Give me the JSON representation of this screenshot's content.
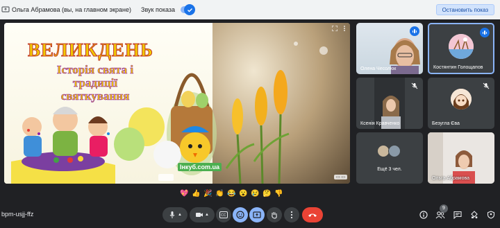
{
  "topbar": {
    "presenter_text": "Ольга Абрамова (вы, на главном экране)",
    "sound_label": "Звук показа",
    "stop_button": "Остановить показ"
  },
  "slide": {
    "title": "ВЕЛИКДЕНЬ",
    "subtitle_line1": "Історія свята і",
    "subtitle_line2": "традиції",
    "subtitle_line3": "святкування",
    "watermark": "Інкуб.com.ua"
  },
  "participants": [
    {
      "name": "Олена Чесолюк",
      "audio": "speaking"
    },
    {
      "name": "Костянтин Голощапов",
      "audio": "speaking"
    },
    {
      "name": "Ксенія Кравченко",
      "audio": "muted"
    },
    {
      "name": "Безугла Єва",
      "audio": "muted"
    },
    {
      "name": "Ещё 3 чел.",
      "audio": "none"
    },
    {
      "name": "Ольга Абрамова",
      "audio": "none"
    }
  ],
  "reactions": [
    "💖",
    "👍",
    "🎉",
    "👏",
    "😂",
    "😮",
    "😢",
    "🤔",
    "👎"
  ],
  "bottombar": {
    "meeting_code": "bpm-usjj-ffz",
    "participants_count": "9"
  },
  "colors": {
    "accent": "#8ab4f8",
    "end_call": "#ea4335",
    "background": "#202124"
  }
}
